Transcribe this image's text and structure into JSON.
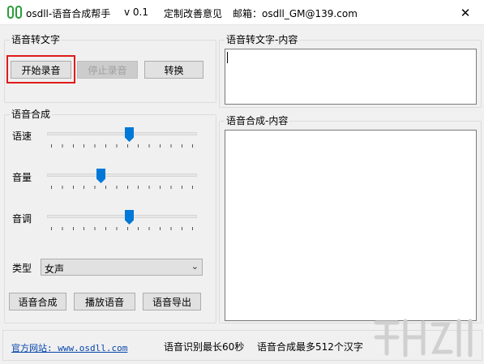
{
  "window": {
    "title": "osdll-语音合成帮手",
    "version": "v 0.1",
    "feedback": "定制改善意见",
    "email": "邮箱：osdll_GM@139.com",
    "close_glyph": "✕"
  },
  "stt": {
    "group_title": "语音转文字",
    "start_label": "开始录音",
    "stop_label": "停止录音",
    "convert_label": "转换",
    "content_title": "语音转文字-内容",
    "content_value": ""
  },
  "tts": {
    "group_title": "语音合成",
    "speed_label": "语速",
    "speed_value": 0.55,
    "volume_label": "音量",
    "volume_value": 0.35,
    "pitch_label": "音调",
    "pitch_value": 0.55,
    "type_label": "类型",
    "type_value": "女声",
    "synth_label": "语音合成",
    "play_label": "播放语音",
    "export_label": "语音导出",
    "content_title": "语音合成-内容",
    "content_value": ""
  },
  "status": {
    "site": "官方网站: www.osdll.com",
    "limit_recognize": "语音识别最长60秒",
    "limit_synth": "语音合成最多512个汉字"
  },
  "colors": {
    "accent": "#0078d7",
    "focus": "#e01b1b",
    "link": "#0645ad"
  }
}
